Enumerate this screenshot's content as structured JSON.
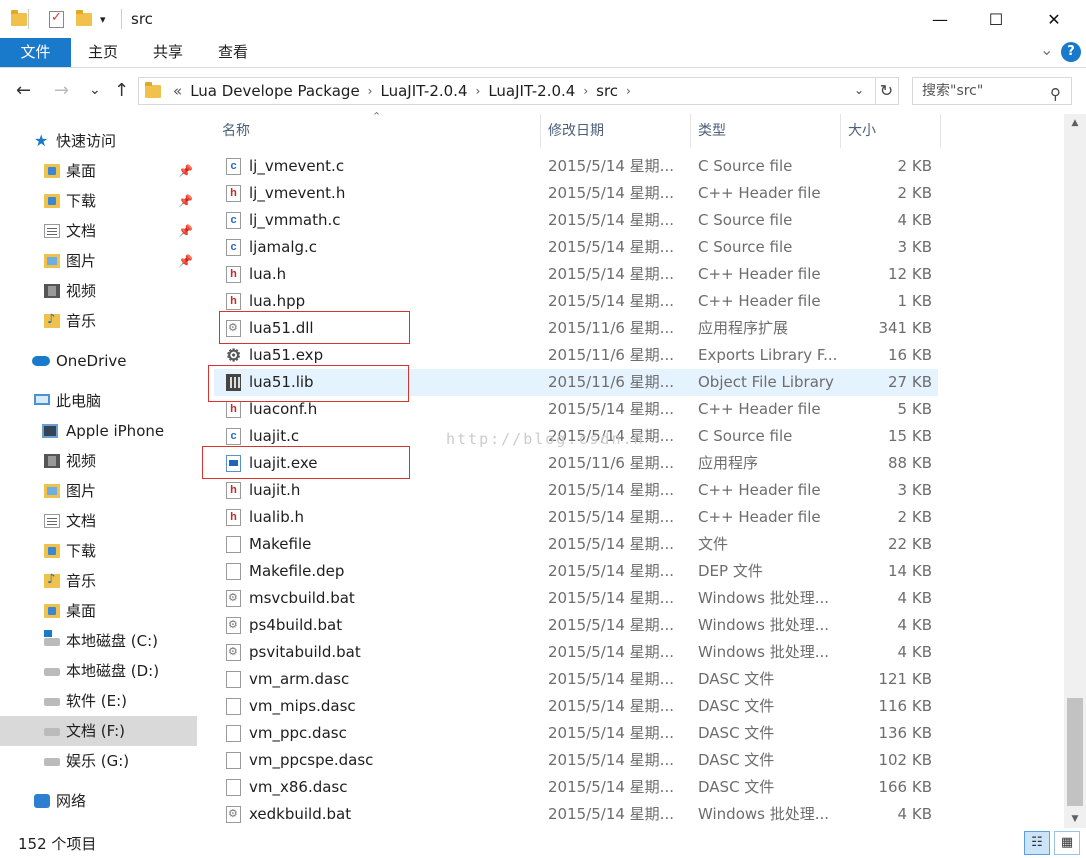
{
  "window": {
    "title": "src",
    "minimize": "—",
    "maximize": "☐",
    "close": "✕"
  },
  "ribbon": {
    "tabs": [
      "文件",
      "主页",
      "共享",
      "查看"
    ],
    "collapse": "⌄",
    "help": "?"
  },
  "nav": {
    "back": "←",
    "forward": "→",
    "recent": "⌄",
    "up": "↑"
  },
  "address": {
    "overflow": "«",
    "crumbs": [
      "Lua Develope Package",
      "LuaJIT-2.0.4",
      "LuaJIT-2.0.4",
      "src"
    ],
    "refresh": "↻"
  },
  "search": {
    "placeholder": "搜索\"src\""
  },
  "sidebar": {
    "quick_access": "快速访问",
    "items": [
      {
        "label": "桌面",
        "icon": "desktop-folder-icon",
        "pinned": true
      },
      {
        "label": "下载",
        "icon": "downloads-folder-icon",
        "pinned": true
      },
      {
        "label": "文档",
        "icon": "documents-folder-icon",
        "pinned": true
      },
      {
        "label": "图片",
        "icon": "pictures-folder-icon",
        "pinned": true
      },
      {
        "label": "视频",
        "icon": "videos-folder-icon",
        "pinned": false
      },
      {
        "label": "音乐",
        "icon": "music-folder-icon",
        "pinned": false
      }
    ],
    "onedrive": "OneDrive",
    "this_pc": "此电脑",
    "pc_items": [
      {
        "label": "Apple iPhone",
        "icon": "phone-icon"
      },
      {
        "label": "视频",
        "icon": "videos-folder-icon"
      },
      {
        "label": "图片",
        "icon": "pictures-folder-icon"
      },
      {
        "label": "文档",
        "icon": "documents-folder-icon"
      },
      {
        "label": "下载",
        "icon": "downloads-folder-icon"
      },
      {
        "label": "音乐",
        "icon": "music-folder-icon"
      },
      {
        "label": "桌面",
        "icon": "desktop-folder-icon"
      },
      {
        "label": "本地磁盘 (C:)",
        "icon": "system-drive-icon"
      },
      {
        "label": "本地磁盘 (D:)",
        "icon": "drive-icon"
      },
      {
        "label": "软件 (E:)",
        "icon": "drive-icon"
      },
      {
        "label": "文档 (F:)",
        "icon": "drive-icon",
        "selected": true
      },
      {
        "label": "娱乐 (G:)",
        "icon": "drive-icon"
      }
    ],
    "network": "网络"
  },
  "columns": {
    "name": "名称",
    "date": "修改日期",
    "type": "类型",
    "size": "大小"
  },
  "files": [
    {
      "name": "lj_vmevent.c",
      "date": "2015/5/14 星期...",
      "type": "C Source file",
      "size": "2 KB",
      "icon": "c"
    },
    {
      "name": "lj_vmevent.h",
      "date": "2015/5/14 星期...",
      "type": "C++ Header file",
      "size": "2 KB",
      "icon": "h"
    },
    {
      "name": "lj_vmmath.c",
      "date": "2015/5/14 星期...",
      "type": "C Source file",
      "size": "4 KB",
      "icon": "c"
    },
    {
      "name": "ljamalg.c",
      "date": "2015/5/14 星期...",
      "type": "C Source file",
      "size": "3 KB",
      "icon": "c"
    },
    {
      "name": "lua.h",
      "date": "2015/5/14 星期...",
      "type": "C++ Header file",
      "size": "12 KB",
      "icon": "h"
    },
    {
      "name": "lua.hpp",
      "date": "2015/5/14 星期...",
      "type": "C++ Header file",
      "size": "1 KB",
      "icon": "h"
    },
    {
      "name": "lua51.dll",
      "date": "2015/11/6 星期...",
      "type": "应用程序扩展",
      "size": "341 KB",
      "icon": "dll",
      "highlight": true
    },
    {
      "name": "lua51.exp",
      "date": "2015/11/6 星期...",
      "type": "Exports Library F...",
      "size": "16 KB",
      "icon": "gear"
    },
    {
      "name": "lua51.lib",
      "date": "2015/11/6 星期...",
      "type": "Object File Library",
      "size": "27 KB",
      "icon": "lib",
      "highlight": true,
      "selected": true
    },
    {
      "name": "luaconf.h",
      "date": "2015/5/14 星期...",
      "type": "C++ Header file",
      "size": "5 KB",
      "icon": "h"
    },
    {
      "name": "luajit.c",
      "date": "2015/5/14 星期...",
      "type": "C Source file",
      "size": "15 KB",
      "icon": "c"
    },
    {
      "name": "luajit.exe",
      "date": "2015/11/6 星期...",
      "type": "应用程序",
      "size": "88 KB",
      "icon": "exe",
      "highlight": true
    },
    {
      "name": "luajit.h",
      "date": "2015/5/14 星期...",
      "type": "C++ Header file",
      "size": "3 KB",
      "icon": "h"
    },
    {
      "name": "lualib.h",
      "date": "2015/5/14 星期...",
      "type": "C++ Header file",
      "size": "2 KB",
      "icon": "h"
    },
    {
      "name": "Makefile",
      "date": "2015/5/14 星期...",
      "type": "文件",
      "size": "22 KB",
      "icon": "blank"
    },
    {
      "name": "Makefile.dep",
      "date": "2015/5/14 星期...",
      "type": "DEP 文件",
      "size": "14 KB",
      "icon": "blank"
    },
    {
      "name": "msvcbuild.bat",
      "date": "2015/5/14 星期...",
      "type": "Windows 批处理...",
      "size": "4 KB",
      "icon": "bat"
    },
    {
      "name": "ps4build.bat",
      "date": "2015/5/14 星期...",
      "type": "Windows 批处理...",
      "size": "4 KB",
      "icon": "bat"
    },
    {
      "name": "psvitabuild.bat",
      "date": "2015/5/14 星期...",
      "type": "Windows 批处理...",
      "size": "4 KB",
      "icon": "bat"
    },
    {
      "name": "vm_arm.dasc",
      "date": "2015/5/14 星期...",
      "type": "DASC 文件",
      "size": "121 KB",
      "icon": "blank"
    },
    {
      "name": "vm_mips.dasc",
      "date": "2015/5/14 星期...",
      "type": "DASC 文件",
      "size": "116 KB",
      "icon": "blank"
    },
    {
      "name": "vm_ppc.dasc",
      "date": "2015/5/14 星期...",
      "type": "DASC 文件",
      "size": "136 KB",
      "icon": "blank"
    },
    {
      "name": "vm_ppcspe.dasc",
      "date": "2015/5/14 星期...",
      "type": "DASC 文件",
      "size": "102 KB",
      "icon": "blank"
    },
    {
      "name": "vm_x86.dasc",
      "date": "2015/5/14 星期...",
      "type": "DASC 文件",
      "size": "166 KB",
      "icon": "blank"
    },
    {
      "name": "xedkbuild.bat",
      "date": "2015/5/14 星期...",
      "type": "Windows 批处理...",
      "size": "4 KB",
      "icon": "bat"
    }
  ],
  "watermark": "http://blog.csdn.n",
  "status": {
    "count": "152 个项目"
  },
  "colors": {
    "accent": "#1979ca",
    "highlight_box": "#d9342b",
    "selection": "#e5f3ff"
  }
}
